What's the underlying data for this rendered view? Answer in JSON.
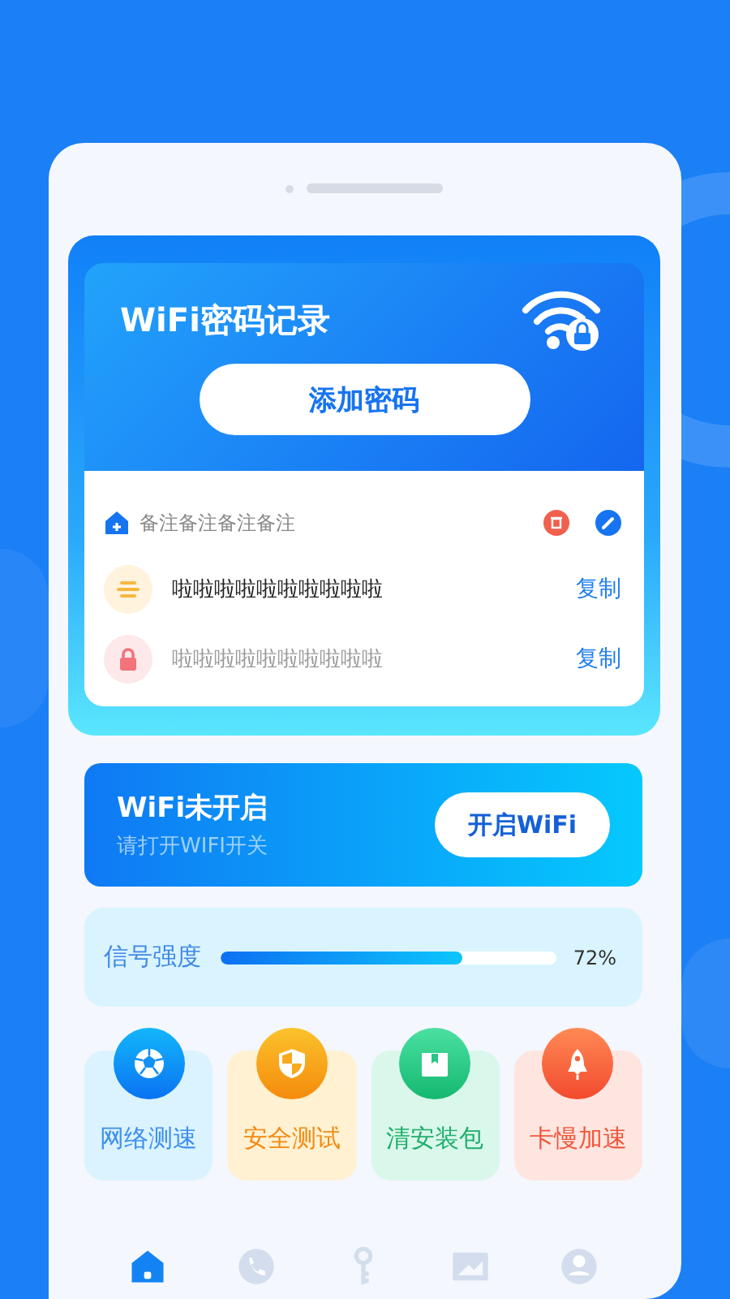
{
  "record_card": {
    "title": "WiFi密码记录",
    "add_button": "添加密码",
    "note": "备注备注备注备注",
    "entries": [
      {
        "kind": "name",
        "text": "啦啦啦啦啦啦啦啦啦啦",
        "copy": "复制"
      },
      {
        "kind": "password",
        "text": "啦啦啦啦啦啦啦啦啦啦",
        "copy": "复制"
      }
    ]
  },
  "wifi_status": {
    "title": "WiFi未开启",
    "subtitle": "请打开WIFI开关",
    "button": "开启WiFi"
  },
  "signal": {
    "label": "信号强度",
    "level": 0.72,
    "reading": "72%"
  },
  "tools": [
    {
      "kind": "speed",
      "label": "网络测速"
    },
    {
      "kind": "security",
      "label": "安全测试"
    },
    {
      "kind": "clean",
      "label": "清安装包"
    },
    {
      "kind": "boost",
      "label": "卡慢加速"
    }
  ],
  "bottom_nav": [
    {
      "kind": "home",
      "selected": true
    },
    {
      "kind": "phone",
      "selected": false
    },
    {
      "kind": "key",
      "selected": false
    },
    {
      "kind": "picture",
      "selected": false
    },
    {
      "kind": "profile",
      "selected": false
    }
  ]
}
